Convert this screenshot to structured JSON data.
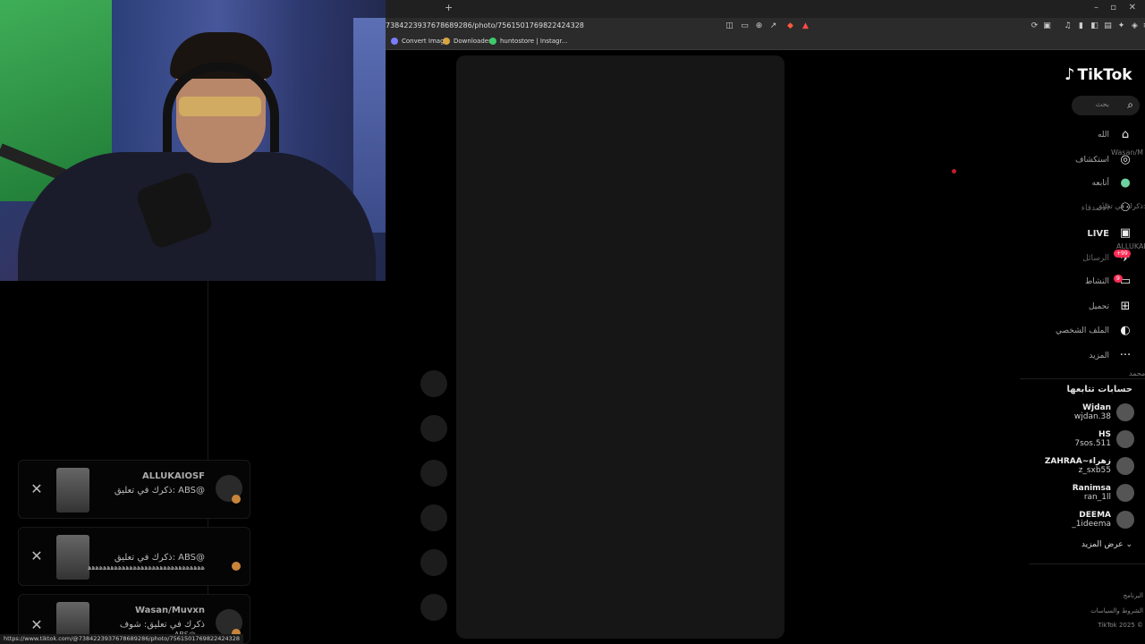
{
  "browser": {
    "new_tab_label": "+",
    "window_controls": [
      "–",
      "▫",
      "✕"
    ],
    "url": "7384223937678689286/photo/7561501769822424328",
    "bookmarks": [
      {
        "label": "Convert Image",
        "color": "#7b7bff"
      },
      {
        "label": "Downloader",
        "color": "#d9a441"
      },
      {
        "label": "huntostore | Instagr...",
        "color": "#3ec96a"
      }
    ],
    "status_url": "https://www.tiktok.com/@7384223937678689286/photo/7561501769822424328"
  },
  "notifications": [
    {
      "name": "ALLUKAIOSF",
      "text": "ذكرك في تعليق: ABS@",
      "text2": ""
    },
    {
      "name": "",
      "text": "ذكرك في تعليق: ABS@",
      "text2": "ﻫﻫﻫﻫﻫﻫﻫﻫﻫﻫﻫﻫﻫﻫﻫﻫﻫﻫﻫﻫﻫﻫﻫﻫﻫﻫﻫﻫﻫﻫﻫ"
    },
    {
      "name": "Wasan/Muvxn",
      "text": "ذكرك في تعليق: شوف",
      "text2": "ABS@ ..."
    }
  ],
  "tiktok": {
    "logo": "TikTok",
    "search_placeholder": "بحث",
    "nav": [
      {
        "label": "الله",
        "icon": "home-icon",
        "glyph": "⌂"
      },
      {
        "label": "استكشاف",
        "icon": "compass-icon",
        "glyph": "◎"
      },
      {
        "label": "أتابعه",
        "icon": "following-icon",
        "glyph": "●"
      },
      {
        "label": "الأصدقاء",
        "icon": "friends-icon",
        "glyph": "⚇"
      },
      {
        "label": "LIVE",
        "icon": "live-icon",
        "glyph": "▣"
      },
      {
        "label": "الرسائل",
        "icon": "messages-icon",
        "glyph": "✈"
      },
      {
        "label": "النشاط",
        "icon": "activity-icon",
        "glyph": "▭"
      },
      {
        "label": "تحميل",
        "icon": "upload-icon",
        "glyph": "⊞"
      },
      {
        "label": "الملف الشخصي",
        "icon": "profile-icon",
        "glyph": "◐"
      },
      {
        "label": "المزيد",
        "icon": "more-icon",
        "glyph": "···"
      }
    ],
    "badges": {
      "messages": "+99",
      "activity": "9"
    },
    "following_title": "حسابات تتابعها",
    "accounts": [
      {
        "name": "Wjdan",
        "user": "wjdan.38"
      },
      {
        "name": "HS",
        "user": "7sos.511"
      },
      {
        "name": "ZAHRAA~زهراء",
        "user": "z_sxb55"
      },
      {
        "name": "Ranimsa",
        "user": "ran_1ll"
      },
      {
        "name": "DEEMA",
        "user": "_1ideema"
      }
    ],
    "see_more": "عرض المزيد",
    "footer": [
      "البرنامج",
      "الشروط والسياسات",
      "TikTok 2025 ©"
    ],
    "ghost_lines": [
      "ذكرك في تعليق: ABS@",
      "ALLUKAIOSF",
      "Wasan/M",
      "محمد"
    ]
  }
}
